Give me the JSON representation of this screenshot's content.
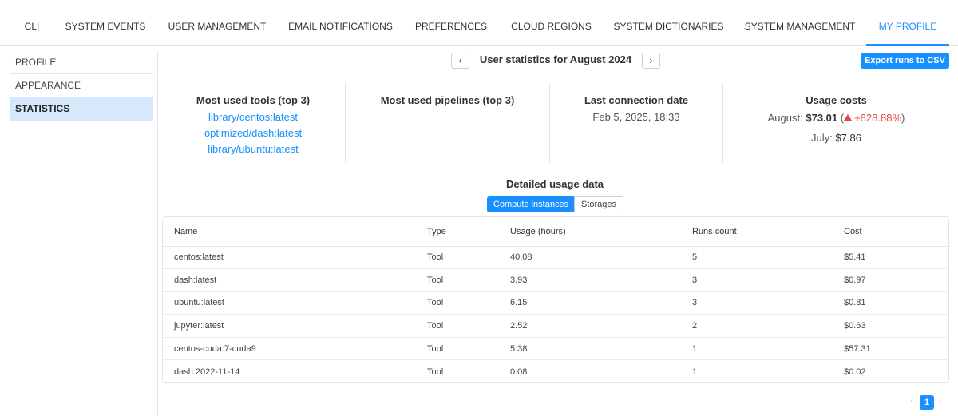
{
  "tabs": [
    "CLI",
    "SYSTEM EVENTS",
    "USER MANAGEMENT",
    "EMAIL NOTIFICATIONS",
    "PREFERENCES",
    "CLOUD REGIONS",
    "SYSTEM DICTIONARIES",
    "SYSTEM MANAGEMENT",
    "MY PROFILE"
  ],
  "active_tab": "MY PROFILE",
  "sidebar": {
    "items": [
      "PROFILE",
      "APPEARANCE",
      "STATISTICS"
    ],
    "active": "STATISTICS"
  },
  "header": {
    "prev_icon": "chevron-left-icon",
    "next_icon": "chevron-right-icon",
    "prev_glyph": "‹",
    "next_glyph": "›",
    "title": "User statistics for August 2024",
    "export_label": "Export runs to CSV"
  },
  "summary": {
    "tools": {
      "title": "Most used tools (top 3)",
      "items": [
        "library/centos:latest",
        "optimized/dash:latest",
        "library/ubuntu:latest"
      ]
    },
    "pipelines": {
      "title": "Most used pipelines (top 3)",
      "items": []
    },
    "connection": {
      "title": "Last connection date",
      "value": "Feb 5, 2025, 18:33"
    },
    "costs": {
      "title": "Usage costs",
      "current_label": "August:",
      "current_value": "$73.01",
      "paren_open": "(",
      "trend_icon": "triangle-up-icon",
      "trend_value": "+828.88%",
      "paren_close": ")",
      "previous_label": "July:",
      "previous_value": "$7.86"
    }
  },
  "detail": {
    "title": "Detailed usage data",
    "segments": [
      "Compute instances",
      "Storages"
    ],
    "active_segment": "Compute instances",
    "columns": [
      "Name",
      "Type",
      "Usage (hours)",
      "Runs count",
      "Cost"
    ],
    "rows": [
      [
        "centos:latest",
        "Tool",
        "40.08",
        "5",
        "$5.41"
      ],
      [
        "dash:latest",
        "Tool",
        "3.93",
        "3",
        "$0.97"
      ],
      [
        "ubuntu:latest",
        "Tool",
        "6.15",
        "3",
        "$0.81"
      ],
      [
        "jupyter:latest",
        "Tool",
        "2.52",
        "2",
        "$0.63"
      ],
      [
        "centos-cuda:7-cuda9",
        "Tool",
        "5.38",
        "1",
        "$57.31"
      ],
      [
        "dash:2022-11-14",
        "Tool",
        "0.08",
        "1",
        "$0.02"
      ]
    ]
  },
  "pagination": {
    "prev_glyph": "‹",
    "next_glyph": "›",
    "current_page": "1"
  },
  "colors": {
    "accent": "#1890ff",
    "active_side_bg": "#d6e9fb",
    "trend_up": "#e64545"
  }
}
